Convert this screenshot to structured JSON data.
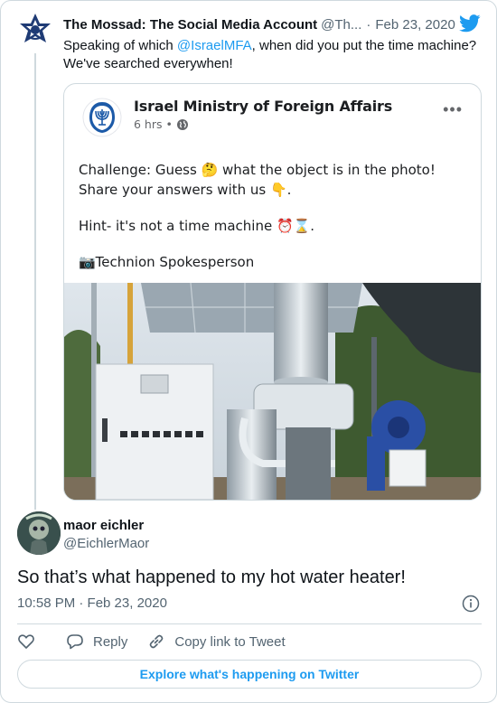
{
  "parent_tweet": {
    "name": "The Mossad: The Social Media Account",
    "handle": "@Th...",
    "date": "Feb 23, 2020",
    "text_before": "Speaking of which ",
    "mention": "@IsraelMFA",
    "text_after": ", when did you put the time machine? We've searched everywhen!",
    "avatar_icon": "mossad-emblem-icon",
    "brand_icon": "twitter-bird-icon"
  },
  "embedded_post": {
    "page_name": "Israel Ministry of Foreign Affairs",
    "time": "6 hrs",
    "dot": "•",
    "privacy_icon": "globe-icon",
    "more_label": "•••",
    "paragraphs": [
      "Challenge: Guess 🤔 what the object is in the photo! Share your answers with us 👇.",
      "Hint- it's not a time machine ⏰⌛.",
      "📷Technion Spokesperson"
    ]
  },
  "reply": {
    "name": "maor eichler",
    "handle": "@EichlerMaor",
    "text": "So that’s what happened to my hot water heater!",
    "time": "10:58 PM · Feb 23, 2020"
  },
  "actions": {
    "like_icon": "heart-icon",
    "reply_label": "Reply",
    "copy_label": "Copy link to Tweet"
  },
  "explore_label": "Explore what's happening on Twitter",
  "colors": {
    "accent": "#1d9bf0",
    "text": "#0f1419",
    "muted": "#536471",
    "border": "#cfd9de"
  }
}
